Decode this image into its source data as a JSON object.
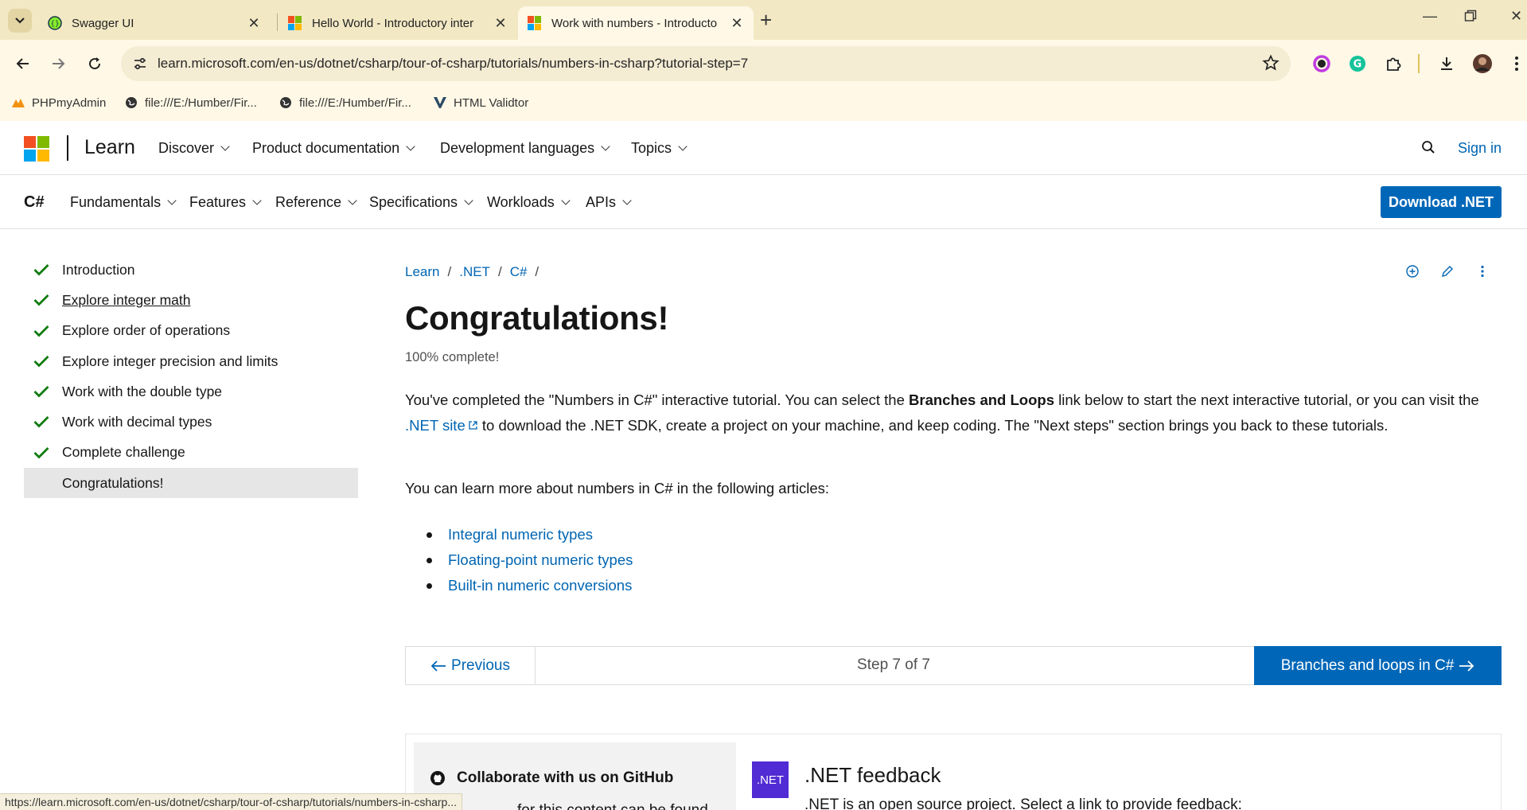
{
  "browser": {
    "tabs": [
      {
        "title": "Swagger UI",
        "icon": "swagger-icon",
        "active": false
      },
      {
        "title": "Hello World - Introductory inter",
        "icon": "microsoft-icon",
        "active": false
      },
      {
        "title": "Work with numbers - Introducto",
        "icon": "microsoft-icon",
        "active": true
      }
    ],
    "url": "learn.microsoft.com/en-us/dotnet/csharp/tour-of-csharp/tutorials/numbers-in-csharp?tutorial-step=7",
    "bookmarks": [
      {
        "label": "PHPmyAdmin",
        "icon": "phpmyadmin-icon"
      },
      {
        "label": "file:///E:/Humber/Fir...",
        "icon": "globe-icon"
      },
      {
        "label": "file:///E:/Humber/Fir...",
        "icon": "globe-icon"
      },
      {
        "label": "HTML Validtor",
        "icon": "validator-icon"
      }
    ],
    "status_url": "https://learn.microsoft.com/en-us/dotnet/csharp/tour-of-csharp/tutorials/numbers-in-csharp..."
  },
  "header": {
    "brand": "Learn",
    "nav": [
      "Discover",
      "Product documentation",
      "Development languages",
      "Topics"
    ],
    "sign_in": "Sign in"
  },
  "subheader": {
    "title": "C#",
    "nav": [
      "Fundamentals",
      "Features",
      "Reference",
      "Specifications",
      "Workloads",
      "APIs"
    ],
    "download": "Download .NET"
  },
  "toc": {
    "items": [
      {
        "label": "Introduction",
        "completed": true
      },
      {
        "label": "Explore integer math",
        "completed": true
      },
      {
        "label": "Explore order of operations",
        "completed": true
      },
      {
        "label": "Explore integer precision and limits",
        "completed": true
      },
      {
        "label": "Work with the double type",
        "completed": true
      },
      {
        "label": "Work with decimal types",
        "completed": true
      },
      {
        "label": "Complete challenge",
        "completed": true
      },
      {
        "label": "Congratulations!",
        "completed": false,
        "selected": true
      }
    ]
  },
  "main": {
    "breadcrumb": [
      "Learn",
      ".NET",
      "C#"
    ],
    "title": "Congratulations!",
    "progress": "100% complete!",
    "para1": {
      "part1": "You've completed the \"Numbers in C#\" interactive tutorial. You can select the ",
      "bold": "Branches and Loops",
      "part2": " link below to start the next interactive tutorial, or you can visit the ",
      "link": ".NET site",
      "part3": " to download the .NET SDK, create a project on your machine, and keep coding. The \"Next steps\" section brings you back to these tutorials."
    },
    "para2": "You can learn more about numbers in C# in the following articles:",
    "links": [
      "Integral numeric types",
      "Floating-point numeric types",
      "Built-in numeric conversions"
    ],
    "step_nav": {
      "previous": "Previous",
      "step": "Step 7 of 7",
      "next": "Branches and loops in C#"
    },
    "feedback": {
      "github_title": "Collaborate with us on GitHub",
      "github_sub": "for this content can be found",
      "net_badge": ".NET",
      "net_title": ".NET feedback",
      "net_sub": ".NET is an open source project. Select a link to provide feedback:"
    }
  },
  "colors": {
    "accent": "#0067b8",
    "link": "#0065b3",
    "check": "#107c10",
    "tabbar": "#f2e8c4"
  }
}
